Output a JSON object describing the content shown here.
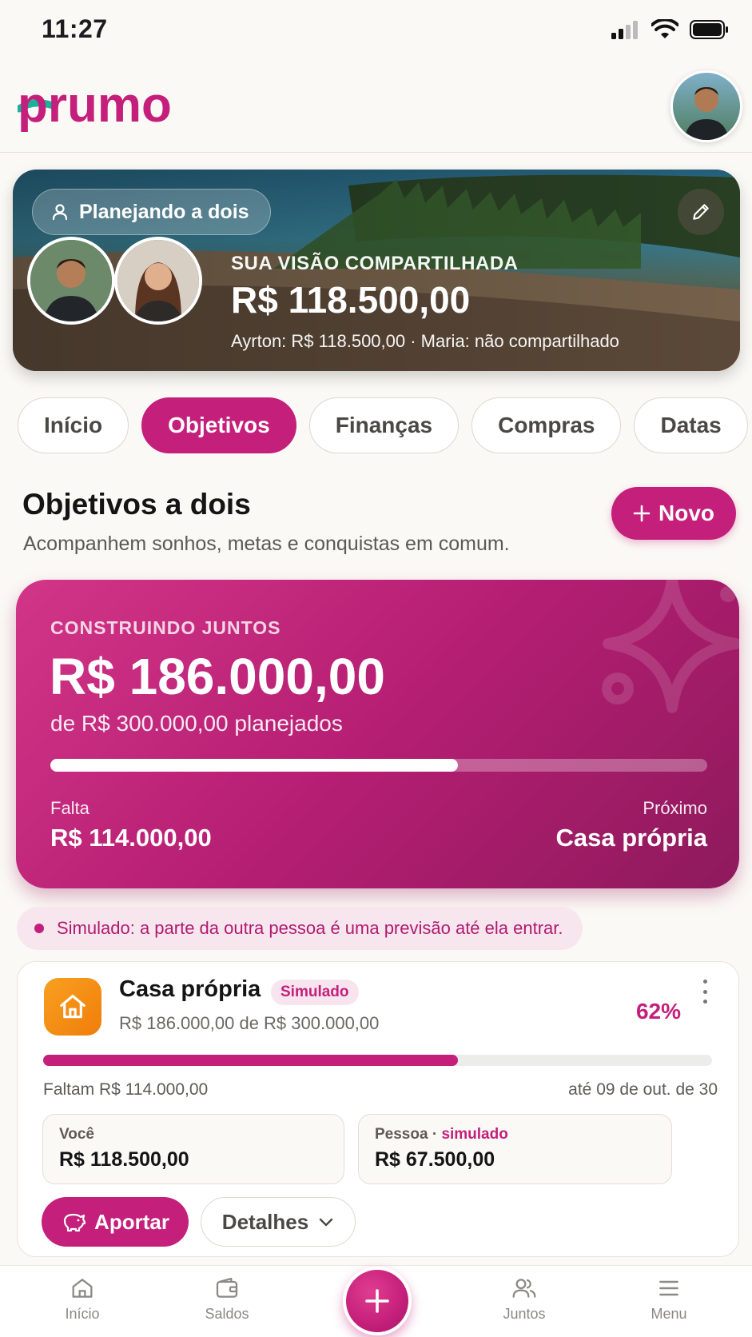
{
  "status_bar": {
    "time": "11:27"
  },
  "header": {
    "logo_text": "prumo"
  },
  "hero": {
    "pill_label": "Planejando a dois",
    "label": "SUA VISÃO COMPARTILHADA",
    "amount": "R$ 118.500,00",
    "breakdown": "Ayrton: R$ 118.500,00  ·  Maria: não compartilhado"
  },
  "tabs": [
    {
      "label": "Início",
      "active": false
    },
    {
      "label": "Objetivos",
      "active": true
    },
    {
      "label": "Finanças",
      "active": false
    },
    {
      "label": "Compras",
      "active": false
    },
    {
      "label": "Datas",
      "active": false
    }
  ],
  "section": {
    "title": "Objetivos a dois",
    "subtitle": "Acompanhem sonhos, metas e conquistas em comum.",
    "new_button": "Novo"
  },
  "summary": {
    "label": "CONSTRUINDO JUNTOS",
    "amount": "R$ 186.000,00",
    "planned": "de R$ 300.000,00 planejados",
    "progress": 0.62,
    "remaining_label": "Falta",
    "remaining_value": "R$ 114.000,00",
    "next_label": "Próximo",
    "next_value": "Casa própria"
  },
  "notice": {
    "text": "Simulado: a parte da outra pessoa é uma previsão até ela entrar."
  },
  "goal": {
    "title": "Casa própria",
    "badge": "Simulado",
    "subtitle": "R$ 186.000,00 de R$ 300.000,00",
    "percent_text": "62%",
    "progress": 0.62,
    "remaining": "Faltam R$ 114.000,00",
    "due": "até 09 de out. de 30",
    "you_label": "Você",
    "you_value": "R$ 118.500,00",
    "other_label": "Pessoa",
    "other_sep": " · ",
    "other_tag": "simulado",
    "other_value": "R$ 67.500,00",
    "contribute_button": "Aportar",
    "details_button": "Detalhes"
  },
  "bottom_nav": {
    "items": [
      {
        "label": "Início",
        "icon": "home-icon"
      },
      {
        "label": "Saldos",
        "icon": "wallet-icon"
      },
      {
        "label": "Juntos",
        "icon": "people-icon"
      },
      {
        "label": "Menu",
        "icon": "menu-icon"
      }
    ]
  },
  "colors": {
    "brand": "#c41f7a",
    "accent_orange": "#f08c12",
    "background": "#fbf9f5"
  }
}
